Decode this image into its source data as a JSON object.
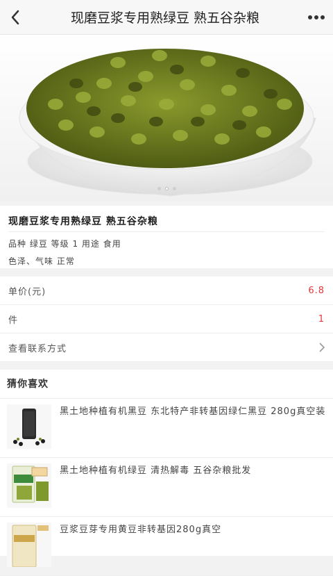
{
  "header": {
    "title": "现磨豆浆专用熟绿豆 熟五谷杂粮",
    "back_icon": "chevron-left-icon",
    "more_icon": "more-dots-icon"
  },
  "gallery": {
    "dot_count": 3,
    "active_index": 1
  },
  "product": {
    "name": "现磨豆浆专用熟绿豆 熟五谷杂粮",
    "spec_line1": "品种 绿豆 等级 1 用途 食用",
    "spec_line2": "色泽、气味 正常"
  },
  "rows": {
    "unit_price_label": "单价(元)",
    "unit_price_value": "6.8",
    "unit_label": "件",
    "unit_value": "1",
    "contact_label": "查看联系方式"
  },
  "guess": {
    "title": "猜你喜欢",
    "items": [
      {
        "title": "黑土地种植有机黑豆 东北特产非转基因绿仁黑豆 280g真空装"
      },
      {
        "title": "黑土地种植有机绿豆 清热解毒 五谷杂粮批发"
      },
      {
        "title": "豆浆豆芽专用黄豆非转基因280g真空"
      }
    ]
  },
  "colors": {
    "accent": "#e6383b",
    "background": "#f2f2f2"
  }
}
